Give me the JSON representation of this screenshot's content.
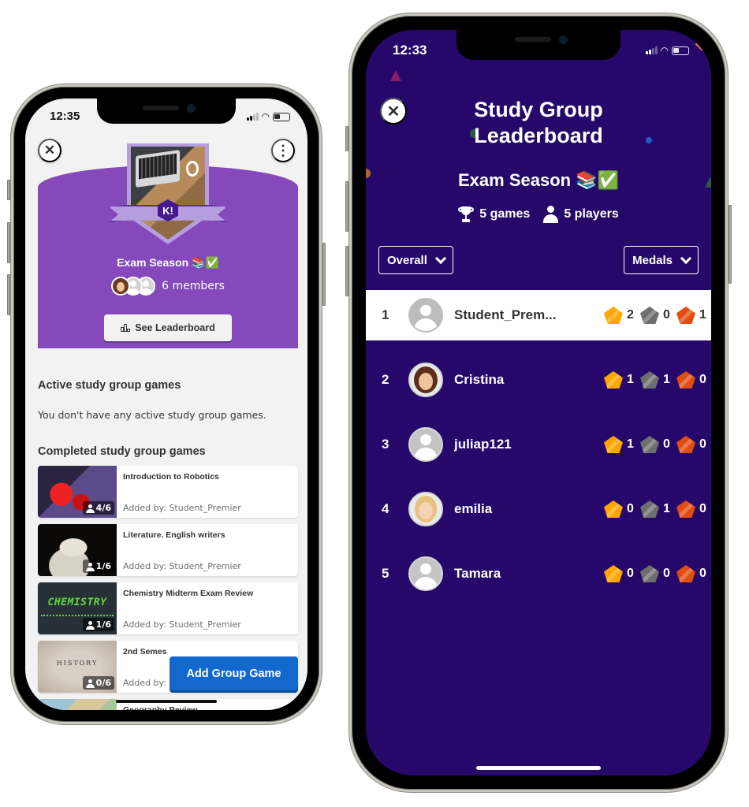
{
  "left_phone": {
    "status_bar": {
      "time": "12:35"
    },
    "group": {
      "name": "Exam Season 📚✅",
      "members_label": "6 members",
      "see_leaderboard_label": "See Leaderboard"
    },
    "active_section": {
      "title": "Active study group games",
      "empty_message": "You don't have any active study group games."
    },
    "completed_section": {
      "title": "Completed study group games",
      "games": [
        {
          "title": "Introduction to Robotics",
          "added_by": "Added by: Student_Premier",
          "players": "4/6",
          "thumb": "robotics",
          "thumb_text": ""
        },
        {
          "title": "Literature. English writers",
          "added_by": "Added by: Student_Premier",
          "players": "1/6",
          "thumb": "literature",
          "thumb_text": ""
        },
        {
          "title": "Chemistry Midterm Exam Review",
          "added_by": "Added by: Student_Premier",
          "players": "1/6",
          "thumb": "chemistry",
          "thumb_text": "CHEMISTRY"
        },
        {
          "title": "2nd Semes",
          "added_by": "Added by: Student_Premier",
          "players": "0/6",
          "thumb": "history",
          "thumb_text": "HISTORY"
        },
        {
          "title": "Geography Review",
          "added_by": "",
          "players": "",
          "thumb": "geo",
          "thumb_text": ""
        }
      ]
    },
    "add_group_game_label": "Add Group Game",
    "icons": {
      "close": "✕",
      "more": "⋮"
    }
  },
  "right_phone": {
    "status_bar": {
      "time": "12:33"
    },
    "title": "Study Group Leaderboard",
    "group_name": "Exam Season 📚✅",
    "stats": {
      "games": "5 games",
      "players": "5 players"
    },
    "filters": {
      "scope": "Overall",
      "metric": "Medals"
    },
    "medal_colors": {
      "gold": "#ffa602",
      "silver": "#6e6e6e",
      "bronze": "#e14d0f"
    },
    "leaderboard": [
      {
        "rank": "1",
        "name": "Student_Prem...",
        "avatar": "blank",
        "gold": "2",
        "silver": "0",
        "bronze": "1",
        "highlight": true
      },
      {
        "rank": "2",
        "name": "Cristina",
        "avatar": "bitmoji-brown",
        "gold": "1",
        "silver": "1",
        "bronze": "0",
        "highlight": false
      },
      {
        "rank": "3",
        "name": "juliap121",
        "avatar": "blank",
        "gold": "1",
        "silver": "0",
        "bronze": "0",
        "highlight": false
      },
      {
        "rank": "4",
        "name": "emilia",
        "avatar": "bitmoji-blonde",
        "gold": "0",
        "silver": "1",
        "bronze": "0",
        "highlight": false
      },
      {
        "rank": "5",
        "name": "Tamara",
        "avatar": "blank",
        "gold": "0",
        "silver": "0",
        "bronze": "0",
        "highlight": false
      }
    ],
    "icons": {
      "close": "✕"
    }
  }
}
